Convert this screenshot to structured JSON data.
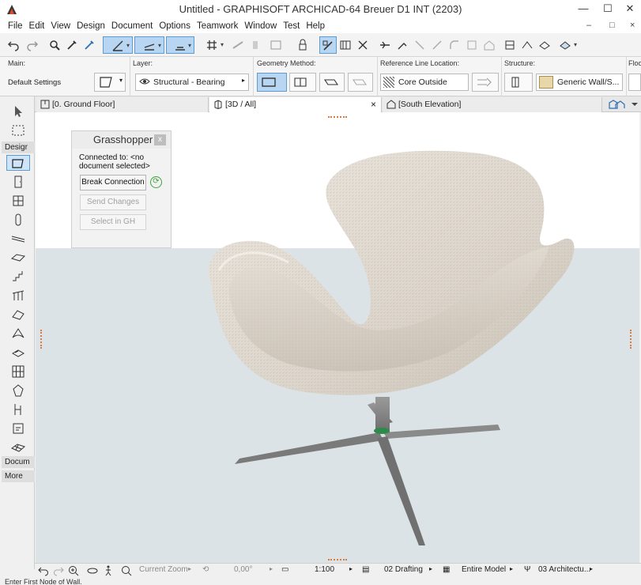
{
  "window": {
    "title": "Untitled - GRAPHISOFT ARCHICAD-64 Breuer D1 INT (2203)",
    "minimize_glyph": "—",
    "maximize_glyph": "☐",
    "close_glyph": "✕"
  },
  "menubar": {
    "items": [
      "File",
      "Edit",
      "View",
      "Design",
      "Document",
      "Options",
      "Teamwork",
      "Window",
      "Test",
      "Help"
    ],
    "mdi_controls": [
      "–",
      "□",
      "×"
    ]
  },
  "infobox": {
    "main_label": "Main:",
    "main_value": "Default Settings",
    "layer_label": "Layer:",
    "layer_value": "Structural - Bearing",
    "geometry_label": "Geometry Method:",
    "refline_label": "Reference Line Location:",
    "refline_value": "Core Outside",
    "structure_label": "Structure:",
    "structure_value": "Generic Wall/S...",
    "floor_label": "Floo"
  },
  "toolbox": {
    "design_label": "Desigr",
    "document_label": "Docum",
    "more_label": "More"
  },
  "tabs": [
    {
      "label": "[0. Ground Floor]"
    },
    {
      "label": "[3D / All]",
      "close": "×"
    },
    {
      "label": "[South Elevation]"
    }
  ],
  "grasshopper": {
    "title": "Grasshopper",
    "close_glyph": "x",
    "connected_line1": "Connected to: <no",
    "connected_line2": "document selected>",
    "break_label": "Break Connection",
    "send_label": "Send Changes",
    "select_label": "Select in GH"
  },
  "bottombar": {
    "zoom_label": "Current Zoom",
    "angle_value": "0,00°",
    "scale_value": "1:100",
    "layer_combo": "02 Drafting",
    "model_view": "Entire Model",
    "pen_set": "03 Architectu..."
  },
  "statusbar": {
    "hint": "Enter First Node of Wall."
  }
}
